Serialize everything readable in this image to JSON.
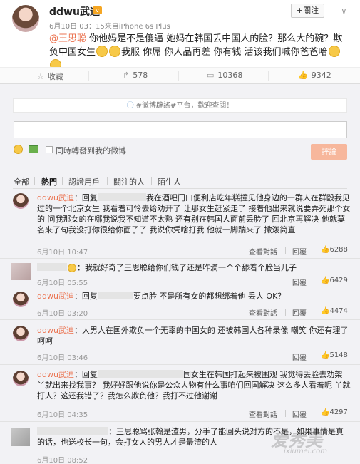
{
  "post": {
    "author": "ddwu武迪",
    "vip": "v",
    "meta": "6月10日 03：15来自iPhone 6s Plus",
    "follow": "+關注",
    "more": "∨",
    "mention": "@王思聪",
    "text1": " 你他妈是不是傻逼 她妈在韩国丢中国人的脸？那么大的碗？欺负中国女生",
    "text2": "我服 你屌 你人品再差 你有钱 活该我们喊你爸爸哈"
  },
  "actions": {
    "collect": "收藏",
    "repost": "578",
    "comments": "10368",
    "likes": "9342"
  },
  "comment_box": {
    "notice": "#微博辟謠#平台，歡迎查閱！",
    "repost_label": "同時轉發到我的微博",
    "submit": "評論"
  },
  "filters": [
    "全部",
    "熱門",
    "認證用戶",
    "關注的人",
    "陌生人"
  ],
  "comments": [
    {
      "user": "ddwu武迪",
      "prefix": "：回复",
      "text": "我在酒吧门口便利店吃年糕撞见他身边的一群人在群殴我见过的一个北京女生 我看着可怜去给劝开了 让那女生赶紧走了 接着他出来就说要弄死那个女的 问我那女的在哪我说我不知道不太熟 还有别在韩国人面前丢脸了 回北京再解决 他就莫名来了句我没打你很给你面子了 我说你凭啥打我 他就一脚踹来了 撒泼简直",
      "time": "6月10日 10:47",
      "view": "查看對話",
      "reply": "回覆",
      "likes": "6288"
    },
    {
      "user": "",
      "prefix": "：",
      "text": "我就好奇了王思聪给你们钱了还是咋滴一个个舔着个脸当儿子",
      "time": "6月10日 05:55",
      "view": "",
      "reply": "回覆",
      "likes": "6429"
    },
    {
      "user": "ddwu武迪",
      "prefix": "：回复",
      "text": "要点脸 不是所有女的都想绑着他 丢人 OK？",
      "time": "6月10日 03:20",
      "view": "查看對話",
      "reply": "回覆",
      "likes": "4474"
    },
    {
      "user": "ddwu武迪",
      "prefix": "：",
      "text": "大男人在国外欺负一个无辜的中国女的 还被韩国人各种录像 嘲笑 你还有理了 呵呵",
      "time": "6月10日 03:46",
      "view": "",
      "reply": "回覆",
      "likes": "5148"
    },
    {
      "user": "ddwu武迪",
      "prefix": "：回复",
      "text": "国女生在韩国打起来被围观 我觉得丢脸去劝架 丫就出来找我事？ 我好好跟他说你是公众人物有什么事咱们回国解决 这么多人看着呢 丫就打人？这还我错了？我怎么欺负他？我打不过他谢谢",
      "time": "6月10日 04:35",
      "view": "查看對話",
      "reply": "回覆",
      "likes": "4297"
    },
    {
      "user": "",
      "prefix": "：",
      "text": "王思聪骂张翰是渣男，分手了能回头说对方的不是，如果事情是真的话，也送校长一句，会打女人的男人才是最渣的人",
      "time": "6月10日 08:52",
      "view": "",
      "reply": "",
      "likes": ""
    }
  ],
  "watermark": "爱秀美",
  "watermark_url": "ixiumei.com"
}
